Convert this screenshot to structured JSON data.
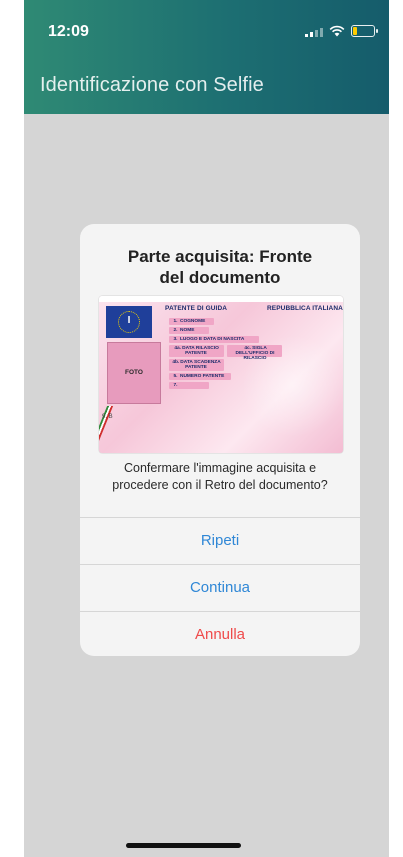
{
  "status": {
    "time": "12:09"
  },
  "header": {
    "title": "Identificazione con Selfie"
  },
  "dialog": {
    "title_line1": "Parte acquisita: Fronte",
    "title_line2": "del documento",
    "license": {
      "flag_letter": "I",
      "head_left": "PATENTE DI GUIDA",
      "head_right": "REPUBBLICA ITALIANA",
      "photo_label": "FOTO",
      "fields": [
        {
          "num": "1.",
          "label": "COGNOME"
        },
        {
          "num": "2.",
          "label": "NOME"
        },
        {
          "num": "3.",
          "label": "LUOGO E DATA DI NASCITA"
        },
        {
          "num": "4a.",
          "label": "DATA RILASCIO PATENTE"
        },
        {
          "num": "4c.",
          "label": "SIGLA DELL'UFFICIO DI RILASCIO"
        },
        {
          "num": "4b.",
          "label": "DATA SCADENZA PATENTE"
        },
        {
          "num": "5.",
          "label": "NUMERO PATENTE"
        },
        {
          "num": "7.",
          "label": ""
        }
      ],
      "category": "9. B"
    },
    "message_line1": "Confermare l'immagine acquisita e",
    "message_line2": "procedere con il Retro del documento?",
    "buttons": {
      "repeat": "Ripeti",
      "continue": "Continua",
      "cancel": "Annulla"
    }
  },
  "colors": {
    "header_start": "#2f8a74",
    "header_end": "#155c6b",
    "action_blue": "#2f87d6",
    "action_red": "#ef4a4a"
  }
}
